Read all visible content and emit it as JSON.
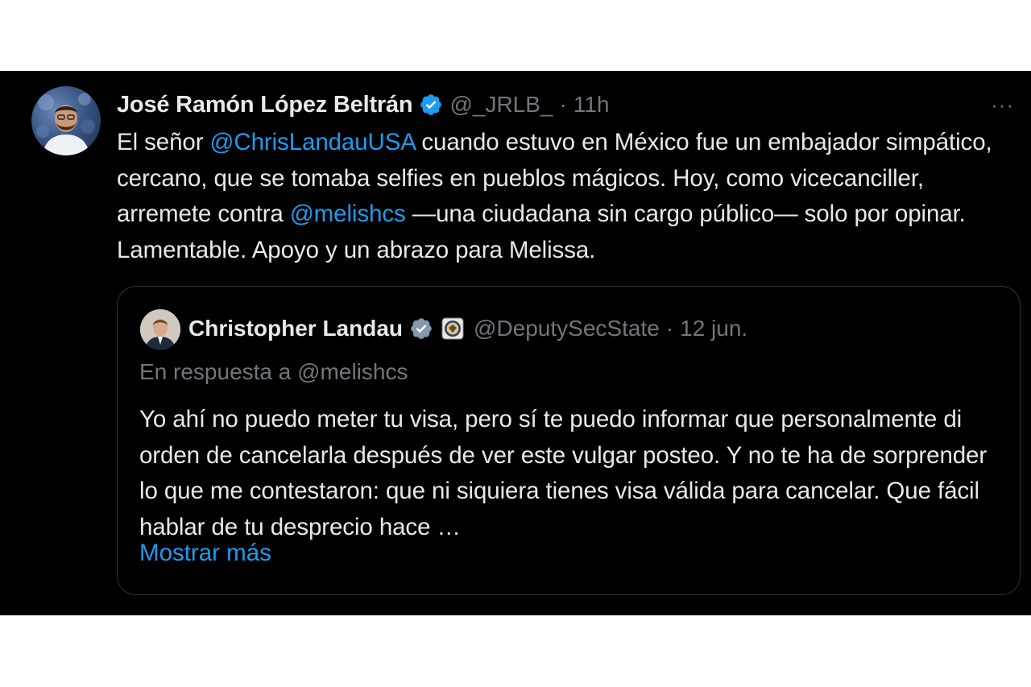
{
  "tweet": {
    "author": {
      "name": "José Ramón López Beltrán",
      "handle": "@_JRLB_",
      "time": "11h",
      "separator": "·"
    },
    "more_label": "···",
    "body": {
      "p1": "El señor ",
      "mention1": "@ChrisLandauUSA",
      "p2": " cuando estuvo en México fue un embajador simpático, cercano, que se tomaba selfies en pueblos mágicos. Hoy, como vicecanciller, arremete contra ",
      "mention2": "@melishcs",
      "p3": " —una ciudadana sin cargo público— solo por opinar. Lamentable. Apoyo y un abrazo para Melissa."
    }
  },
  "quote": {
    "author": {
      "name": "Christopher Landau",
      "handle": "@DeputySecState",
      "time": "12 jun.",
      "separator": "·"
    },
    "reply_to": "En respuesta a @melishcs",
    "text": "Yo ahí no puedo meter tu visa, pero sí te puedo informar que personalmente di orden de cancelarla después de ver este vulgar posteo. Y no te ha de sorprender lo que me contestaron: que ni siquiera tienes visa válida para cancelar. Que fácil hablar de tu desprecio hace …",
    "show_more": "Mostrar más"
  },
  "colors": {
    "background": "#000000",
    "text": "#e7e9ea",
    "muted": "#71767b",
    "link": "#1d9bf0",
    "verified_blue": "#1d9bf0",
    "verified_gray": "#829aab",
    "border": "#2f3336"
  },
  "icons": {
    "verified": "verified-badge-icon",
    "gov_verified": "gray-verified-badge-icon",
    "affiliation": "us-state-seal-icon",
    "more": "more-dots-icon"
  }
}
